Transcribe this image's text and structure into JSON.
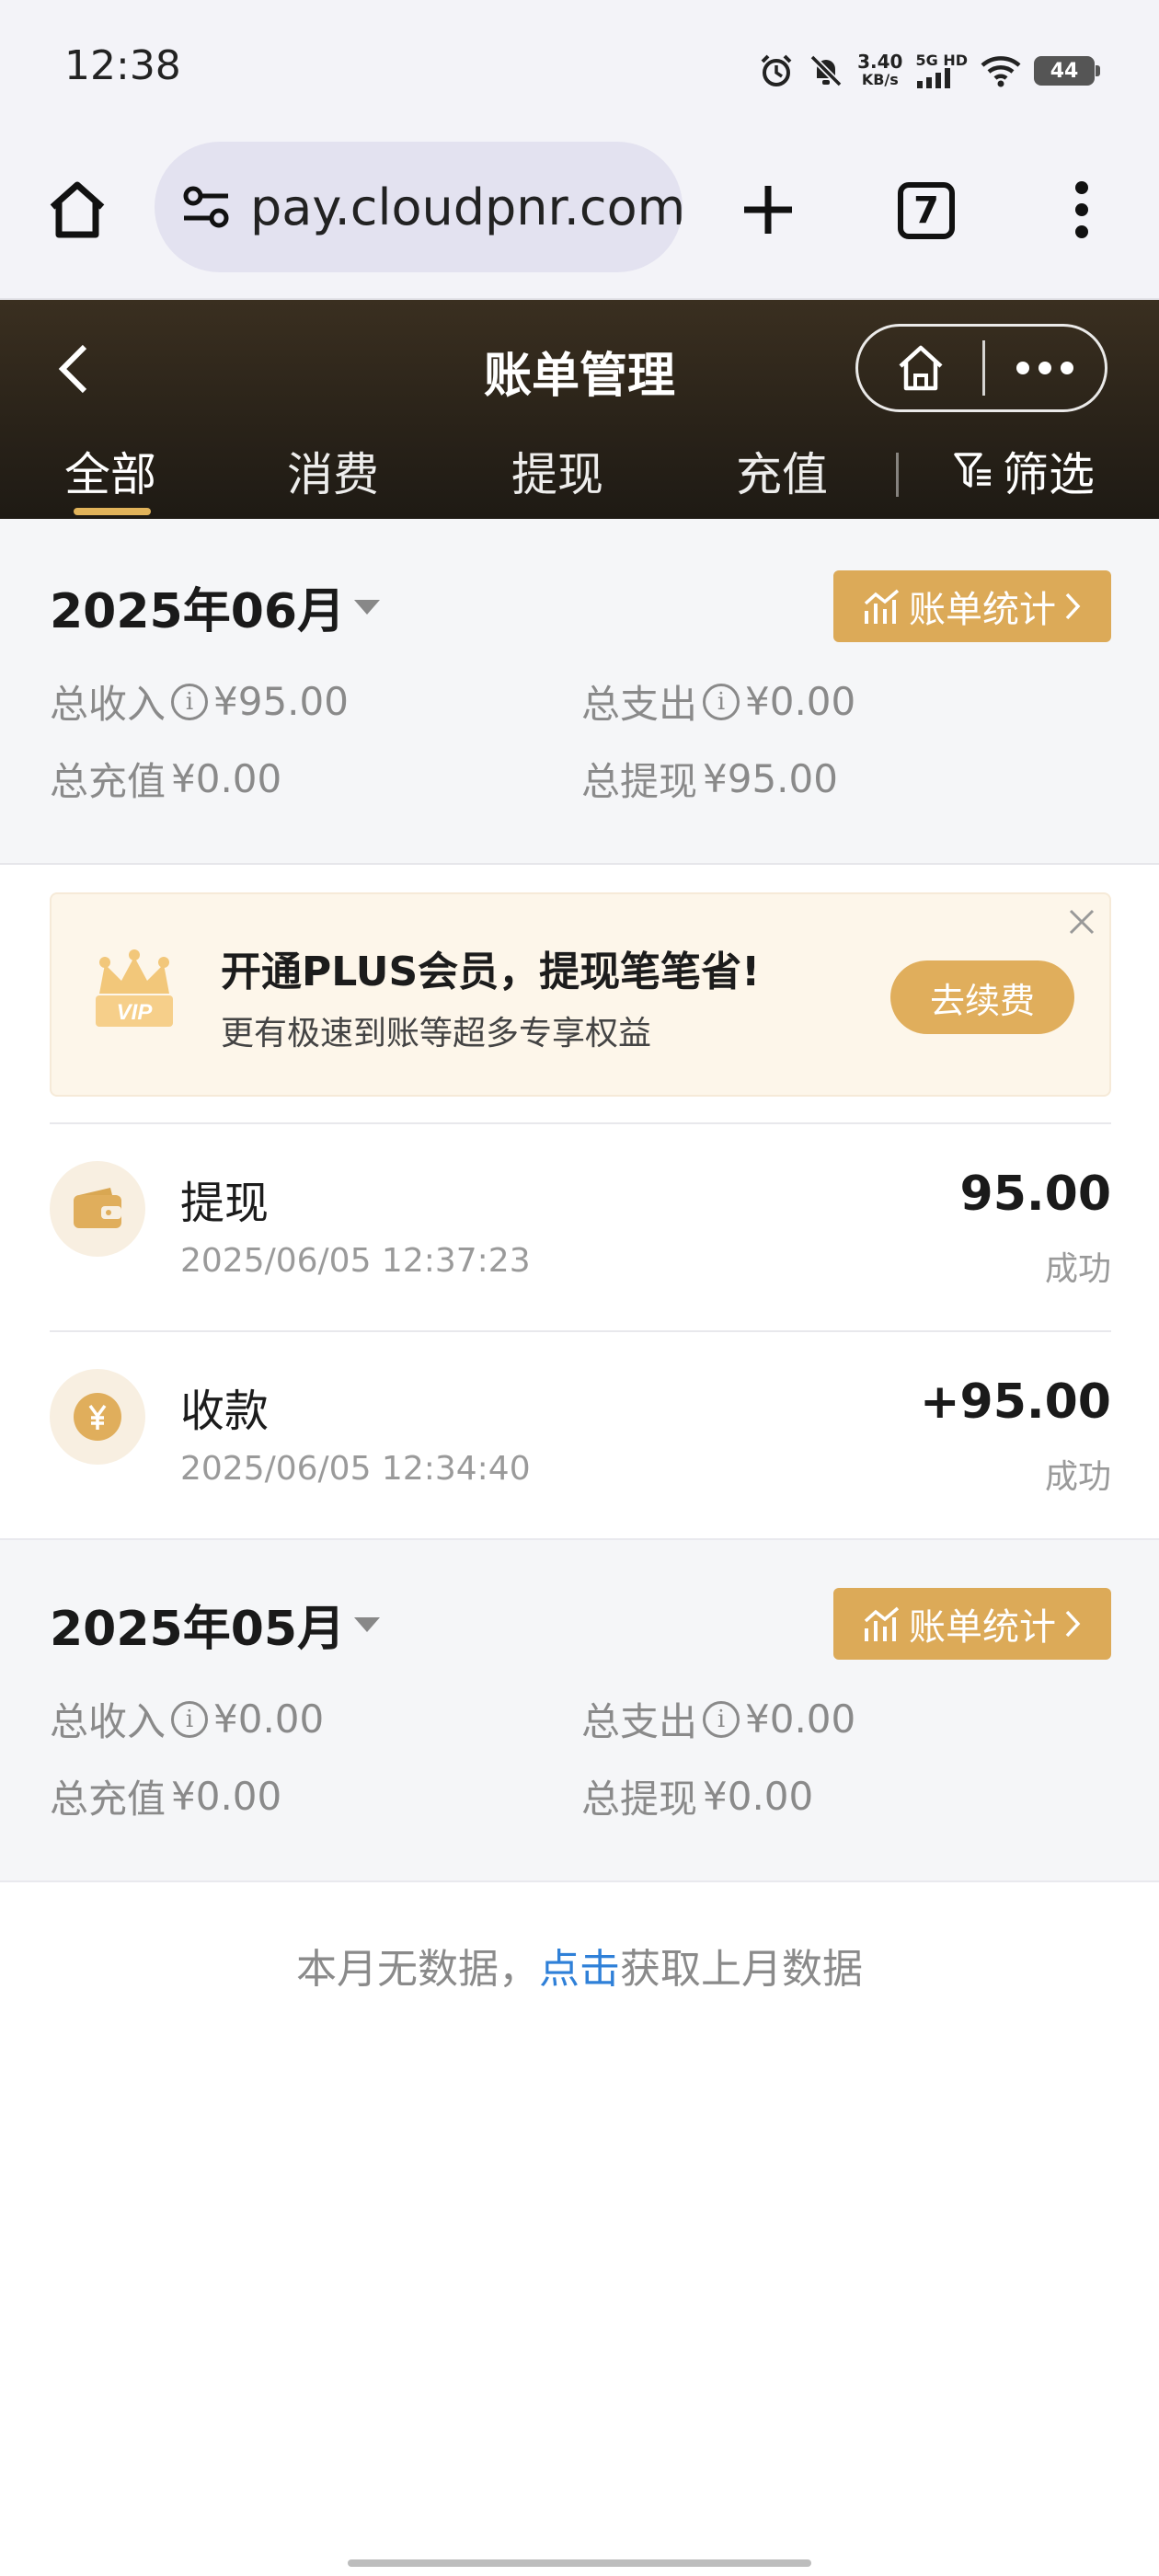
{
  "status_bar": {
    "time": "12:38",
    "net_speed_value": "3.40",
    "net_speed_unit": "KB/s",
    "signal_label": "5G HD",
    "battery": "44"
  },
  "browser": {
    "url": "pay.cloudpnr.com",
    "tab_count": "7"
  },
  "header": {
    "title": "账单管理"
  },
  "tabs": [
    {
      "label": "全部",
      "active": true
    },
    {
      "label": "消费",
      "active": false
    },
    {
      "label": "提现",
      "active": false
    },
    {
      "label": "充值",
      "active": false
    }
  ],
  "filter_label": "筛选",
  "months": [
    {
      "title": "2025年06月",
      "stat_button": "账单统计",
      "income_label": "总收入",
      "income_value": "¥95.00",
      "expense_label": "总支出",
      "expense_value": "¥0.00",
      "recharge_label": "总充值",
      "recharge_value": "¥0.00",
      "withdraw_label": "总提现",
      "withdraw_value": "¥95.00"
    },
    {
      "title": "2025年05月",
      "stat_button": "账单统计",
      "income_label": "总收入",
      "income_value": "¥0.00",
      "expense_label": "总支出",
      "expense_value": "¥0.00",
      "recharge_label": "总充值",
      "recharge_value": "¥0.00",
      "withdraw_label": "总提现",
      "withdraw_value": "¥0.00"
    }
  ],
  "promo": {
    "badge": "VIP",
    "title": "开通PLUS会员，提现笔笔省!",
    "subtitle": "更有极速到账等超多专享权益",
    "button": "去续费"
  },
  "transactions": [
    {
      "name": "提现",
      "time": "2025/06/05 12:37:23",
      "amount": "95.00",
      "status": "成功",
      "icon": "wallet-icon"
    },
    {
      "name": "收款",
      "time": "2025/06/05 12:34:40",
      "amount": "+95.00",
      "status": "成功",
      "icon": "yuan-coin-icon"
    }
  ],
  "empty_state": {
    "prefix": "本月无数据，",
    "link": "点击",
    "suffix": "获取上月数据"
  },
  "colors": {
    "gold": "#dcaa58",
    "header_dark": "#2a2319",
    "link_blue": "#2f80d8"
  }
}
